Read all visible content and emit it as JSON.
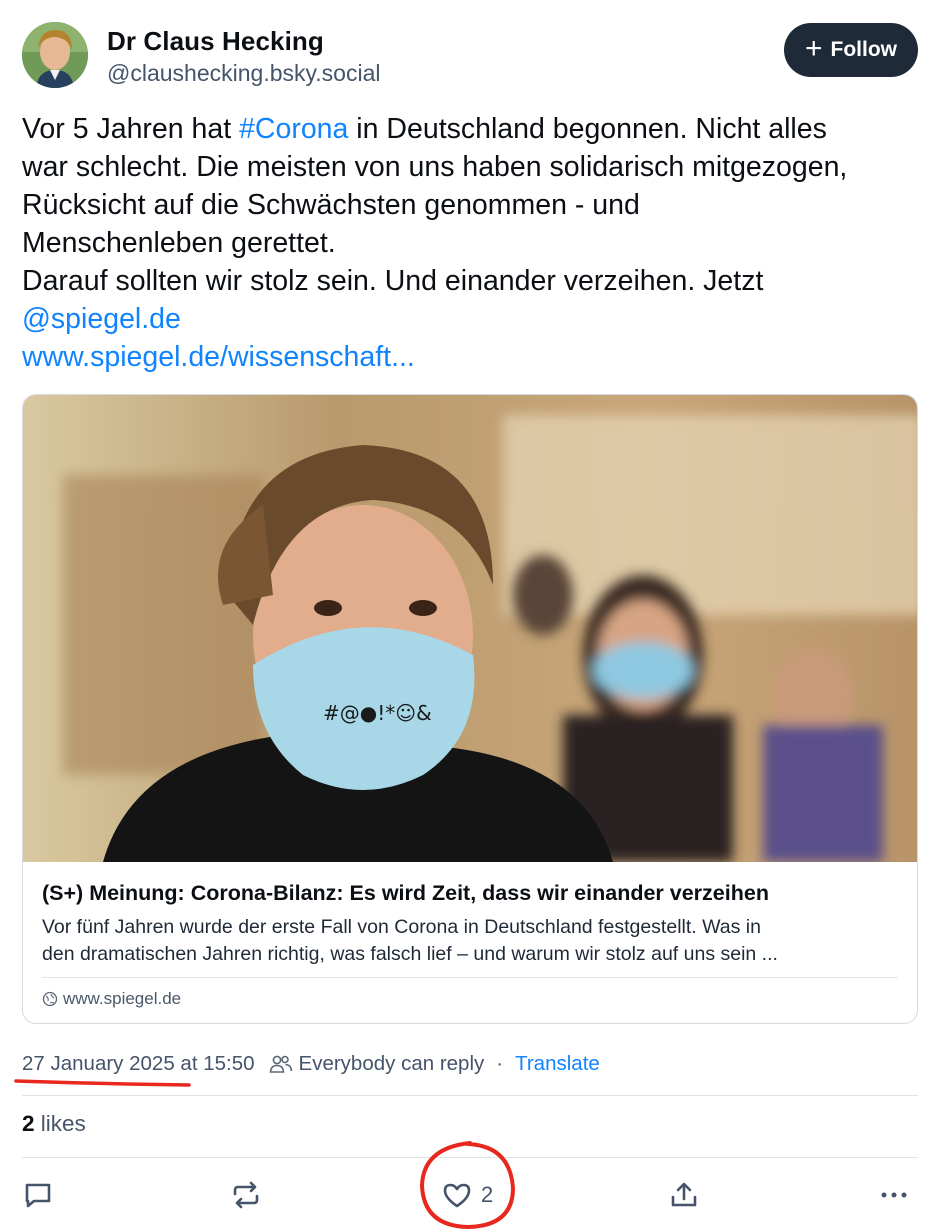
{
  "author": {
    "name": "Dr Claus Hecking",
    "handle": "@claushecking.bsky.social",
    "avatar_icon": "avatar-photo"
  },
  "follow_button": {
    "label": "Follow",
    "icon": "plus-icon"
  },
  "post": {
    "line1_pre": "Vor 5 Jahren hat ",
    "hashtag": "#Corona",
    "line1_post": " in Deutschland begonnen. Nicht alles",
    "line2": "war schlecht. Die meisten von uns haben solidarisch mitgezogen,",
    "line3": "Rücksicht auf die Schwächsten genommen - und",
    "line4": "Menschenleben gerettet.",
    "line5": "Darauf sollten wir stolz sein. Und einander verzeihen. Jetzt",
    "mention": "@spiegel.de",
    "url": "www.spiegel.de/wissenschaft..."
  },
  "link_card": {
    "title": "(S+) Meinung: Corona-Bilanz: Es wird Zeit, dass wir einander verzeihen",
    "desc_line1": "Vor fünf Jahren wurde der erste Fall von Corona in Deutschland festgestellt. Was in",
    "desc_line2": "den dramatischen Jahren richtig, was falsch lief – und warum wir stolz auf uns sein ...",
    "domain": "www.spiegel.de",
    "image_desc_icon": "masked-student-photo"
  },
  "meta": {
    "timestamp": "27 January 2025 at 15:50",
    "reply_setting": "Everybody can reply",
    "separator": "·",
    "translate": "Translate"
  },
  "likes": {
    "count": "2",
    "label": "likes"
  },
  "actions": {
    "reply_icon": "comment-icon",
    "repost_icon": "repost-icon",
    "like_icon": "heart-icon",
    "like_count": "2",
    "share_icon": "share-icon",
    "more_icon": "more-icon"
  },
  "colors": {
    "accent": "#1083fe",
    "follow_bg": "#1e2a37",
    "annotation_red": "#e8281e"
  }
}
